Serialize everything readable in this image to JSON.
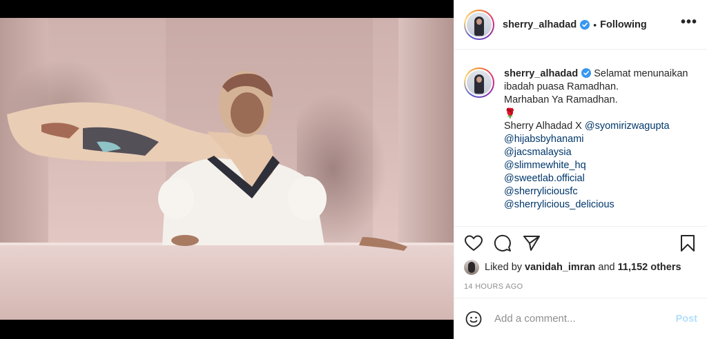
{
  "post": {
    "author": "sherry_alhadad",
    "follow_separator": "•",
    "follow_status": "Following",
    "more_label": "•••"
  },
  "caption": {
    "username": "sherry_alhadad",
    "lines": [
      "Selamat menunaikan ibadah puasa Ramadhan.",
      "Marhaban Ya Ramadhan."
    ],
    "emoji": "🌹",
    "credit_prefix": "Sherry Alhadad X",
    "mentions": [
      "@syomirizwagupta",
      "@hijabsbyhanami",
      "@jacsmalaysia",
      "@slimmewhite_hq",
      "@sweetlab.official",
      "@sherryliciousfc",
      "@sherrylicious_delicious"
    ]
  },
  "actions": {
    "like_icon": "heart-icon",
    "comment_icon": "comment-icon",
    "share_icon": "share-icon",
    "save_icon": "bookmark-icon"
  },
  "likes": {
    "prefix": "Liked by",
    "user": "vanidah_imran",
    "conjunction": "and",
    "others": "11,152 others"
  },
  "timestamp": "14 HOURS AGO",
  "comment": {
    "placeholder": "Add a comment...",
    "post_label": "Post"
  },
  "colors": {
    "link": "#00376b",
    "verified": "#3897f0",
    "post_disabled": "#b2dffc",
    "muted": "#8e8e8e"
  }
}
